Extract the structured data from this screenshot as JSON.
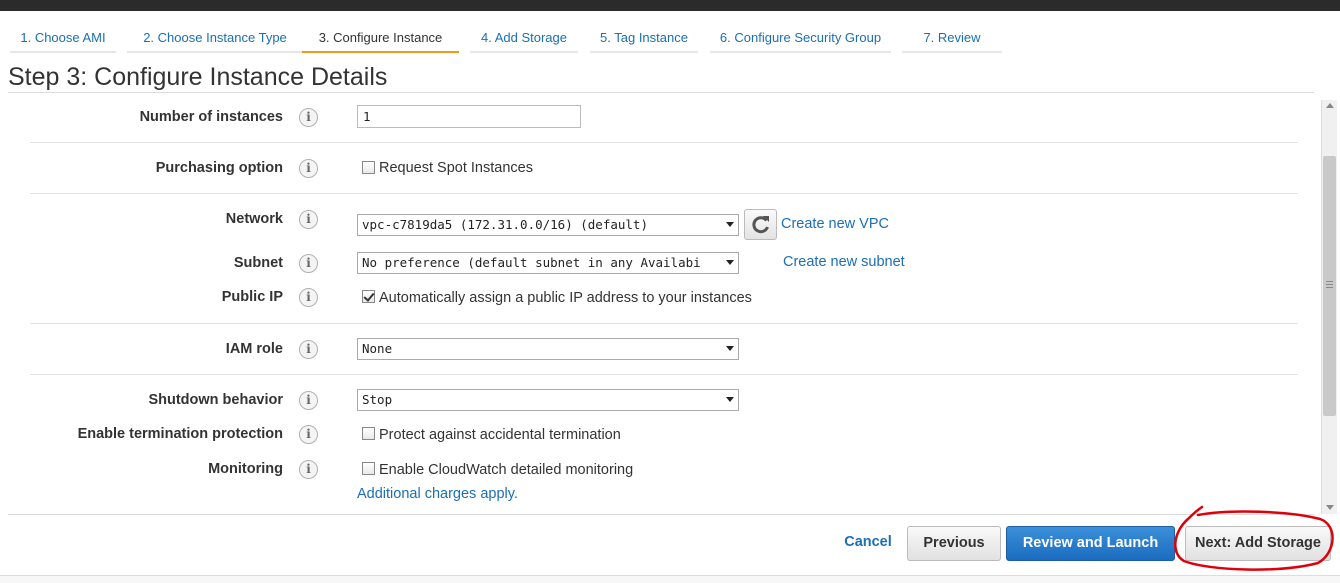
{
  "wizard": {
    "tabs": [
      {
        "label": "1. Choose AMI"
      },
      {
        "label": "2. Choose Instance Type"
      },
      {
        "label": "3. Configure Instance"
      },
      {
        "label": "4. Add Storage"
      },
      {
        "label": "5. Tag Instance"
      },
      {
        "label": "6. Configure Security Group"
      },
      {
        "label": "7. Review"
      }
    ],
    "active_tab": 2,
    "active_color": "#f09a1a"
  },
  "page": {
    "title": "Step 3: Configure Instance Details"
  },
  "form": {
    "number_of_instances": {
      "label": "Number of instances",
      "value": "1"
    },
    "purchasing_option": {
      "label": "Purchasing option",
      "checkbox_label": "Request Spot Instances",
      "checked": false
    },
    "network": {
      "label": "Network",
      "value": "vpc-c7819da5 (172.31.0.0/16) (default)",
      "link": "Create new VPC"
    },
    "subnet": {
      "label": "Subnet",
      "value": "No preference (default subnet in any Availabi",
      "link": "Create new subnet"
    },
    "public_ip": {
      "label": "Public IP",
      "checkbox_label": "Automatically assign a public IP address to your instances",
      "checked": true
    },
    "iam_role": {
      "label": "IAM role",
      "value": "None"
    },
    "shutdown_behavior": {
      "label": "Shutdown behavior",
      "value": "Stop"
    },
    "termination_protection": {
      "label": "Enable termination protection",
      "checkbox_label": "Protect against accidental termination",
      "checked": false
    },
    "monitoring": {
      "label": "Monitoring",
      "checkbox_label": "Enable CloudWatch detailed monitoring",
      "checked": false,
      "note_link": "Additional charges apply."
    },
    "info_glyph": "i"
  },
  "footer": {
    "cancel": "Cancel",
    "previous": "Previous",
    "review_and_launch": "Review and Launch",
    "next": "Next: Add Storage",
    "primary_color": "#1b6cc0",
    "annotation_color": "#e0000a"
  },
  "icons": {
    "refresh": "refresh-icon",
    "info": "info-icon"
  }
}
